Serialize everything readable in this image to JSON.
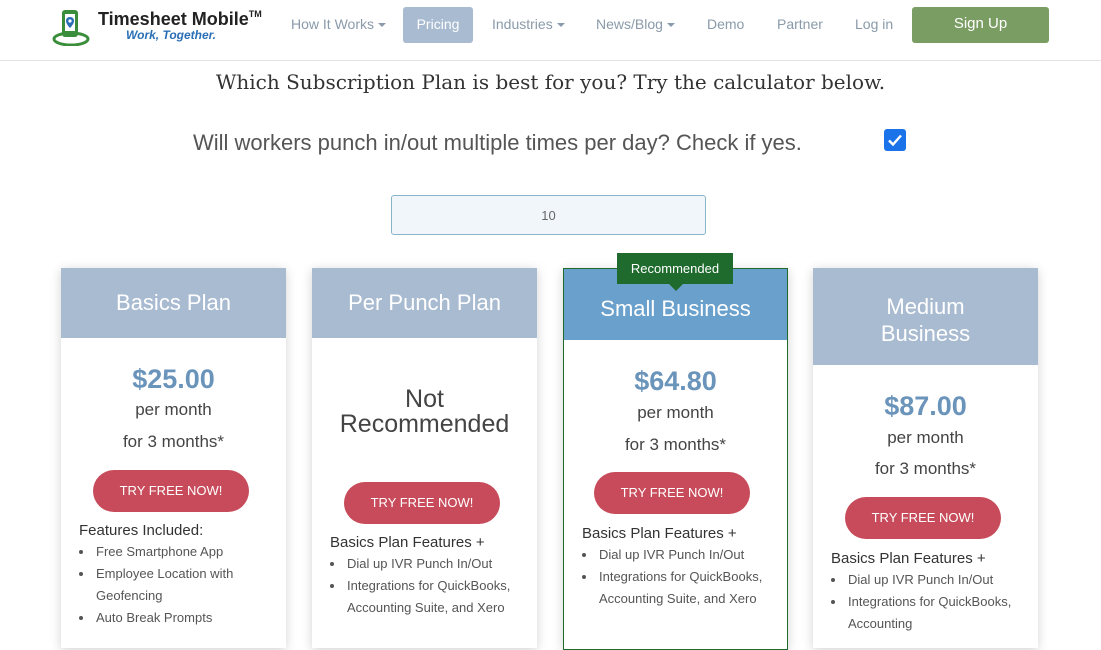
{
  "header": {
    "logo_title": "Timesheet Mobile",
    "logo_tm": "TM",
    "logo_tagline": "Work, Together.",
    "nav": [
      {
        "label": "How It Works",
        "dropdown": true
      },
      {
        "label": "Pricing",
        "active": true
      },
      {
        "label": "Industries",
        "dropdown": true
      },
      {
        "label": "News/Blog",
        "dropdown": true
      },
      {
        "label": "Demo"
      },
      {
        "label": "Partner"
      },
      {
        "label": "Log in"
      }
    ],
    "signup_label": "Sign Up"
  },
  "calculator": {
    "heading": "Which Subscription Plan is best for you?  Try the calculator below.",
    "question": "Will workers punch in/out multiple times per day? Check if yes.",
    "multiple_punch_checked": true,
    "workers_value": "10"
  },
  "recommended_badge": "Recommended",
  "plans": [
    {
      "name": "Basics Plan",
      "price": "$25.00",
      "per": "per month",
      "term": "for 3 months*",
      "button": "TRY FREE NOW!",
      "features_title": "Features Included:",
      "features": [
        "Free Smartphone App",
        "Employee Location with Geofencing",
        "Auto Break Prompts"
      ]
    },
    {
      "name": "Per Punch Plan",
      "price_note": "Not Recommended",
      "button": "TRY FREE NOW!",
      "features_title": "Basics Plan Features +",
      "features": [
        "Dial up IVR Punch In/Out",
        "Integrations for QuickBooks, Accounting Suite, and Xero"
      ]
    },
    {
      "name": "Small Business",
      "recommended": true,
      "price": "$64.80",
      "per": "per month",
      "term": "for 3 months*",
      "button": "TRY FREE NOW!",
      "features_title": "Basics Plan Features +",
      "features": [
        "Dial up IVR Punch In/Out",
        "Integrations for QuickBooks, Accounting Suite, and Xero"
      ]
    },
    {
      "name": "Medium Business",
      "price": "$87.00",
      "per": "per month",
      "term": "for 3 months*",
      "button": "TRY FREE NOW!",
      "features_title": "Basics Plan Features +",
      "features": [
        "Dial up IVR Punch In/Out",
        "Integrations for QuickBooks, Accounting"
      ]
    }
  ],
  "colors": {
    "plan_header": "#a8bbd1",
    "recommended_header": "#6aa0cc",
    "recommended_badge": "#1f6b2e",
    "price": "#6b94bb",
    "cta": "#c74b5a",
    "signup": "#7a9d63"
  }
}
